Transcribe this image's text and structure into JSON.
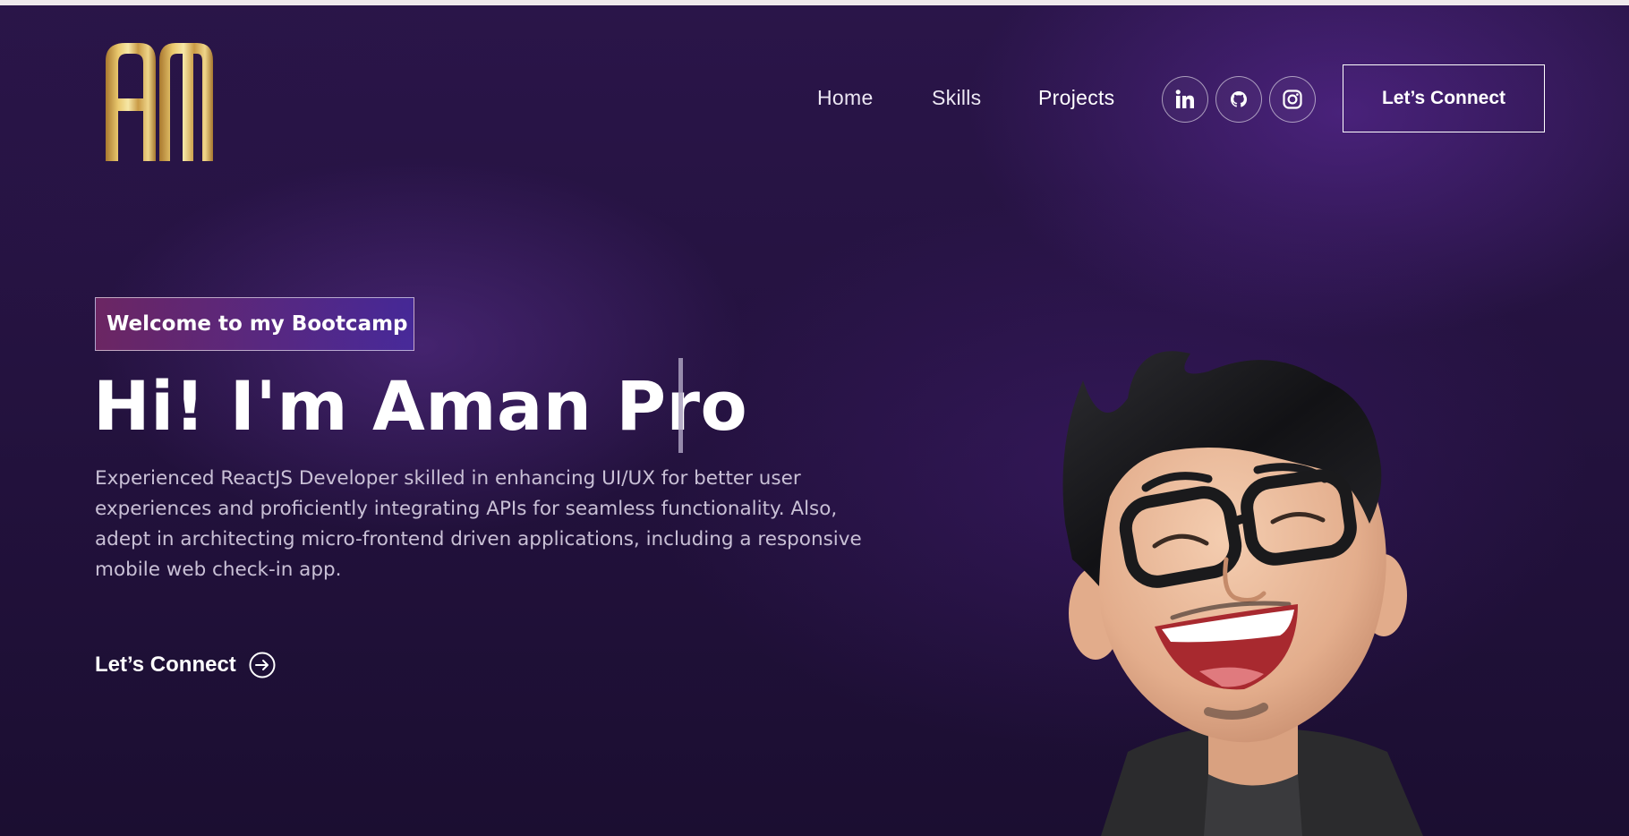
{
  "nav": {
    "links": [
      "Home",
      "Skills",
      "Projects"
    ],
    "social_icons": [
      "linkedin-icon",
      "github-icon",
      "instagram-icon"
    ],
    "connect_label": "Let’s Connect"
  },
  "hero": {
    "tagline": "Welcome to my Bootcamp",
    "headline": "Hi! I'm Aman Pro",
    "description": "Experienced ReactJS Developer skilled in enhancing UI/UX for better user experiences and proficiently integrating APIs for seamless functionality. Also, adept in architecting micro-frontend driven applications, including a responsive mobile web check-in app.",
    "connect_label": "Let’s Connect",
    "connect_icon": "arrow-circle-right-icon"
  },
  "colors": {
    "background": "#24123f",
    "logo_gold": "#c9a24a",
    "tagline_gradient_start": "#aa367c",
    "tagline_gradient_end": "#4a2fbd",
    "text_muted": "#c9c0d6"
  }
}
